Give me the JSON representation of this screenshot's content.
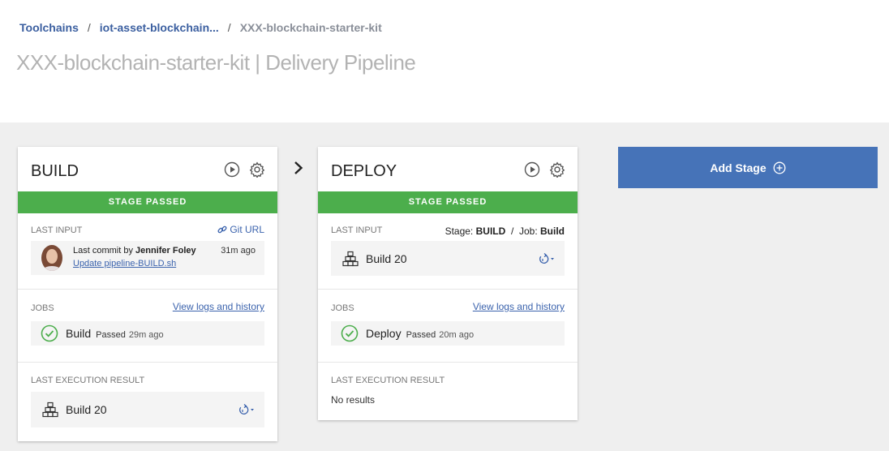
{
  "breadcrumb": {
    "toolchains": "Toolchains",
    "separator": "/",
    "toolchain": "iot-asset-blockchain...",
    "current": "XXX-blockchain-starter-kit"
  },
  "page_title": "XXX-blockchain-starter-kit | Delivery Pipeline",
  "colors": {
    "passed": "#4cae4c",
    "accent": "#4673b8",
    "link": "#3b63ad"
  },
  "stages": {
    "build": {
      "name": "BUILD",
      "status": "STAGE PASSED",
      "last_input_label": "LAST INPUT",
      "git_url_label": "Git URL",
      "commit": {
        "prefix": "Last commit by",
        "author": "Jennifer Foley",
        "time": "31m ago",
        "message": "Update pipeline-BUILD.sh"
      },
      "jobs_label": "JOBS",
      "view_logs": "View logs and history",
      "job": {
        "name": "Build",
        "status": "Passed",
        "time": "29m ago"
      },
      "last_result_label": "LAST EXECUTION RESULT",
      "result_build": "Build 20"
    },
    "deploy": {
      "name": "DEPLOY",
      "status": "STAGE PASSED",
      "last_input_label": "LAST INPUT",
      "source_stage_label": "Stage:",
      "source_stage": "BUILD",
      "source_sep": "/",
      "source_job_label": "Job:",
      "source_job": "Build",
      "input_build": "Build 20",
      "jobs_label": "JOBS",
      "view_logs": "View logs and history",
      "job": {
        "name": "Deploy",
        "status": "Passed",
        "time": "20m ago"
      },
      "last_result_label": "LAST EXECUTION RESULT",
      "no_results": "No results"
    }
  },
  "add_stage_label": "Add Stage",
  "icons": [
    "play-icon",
    "gear-icon",
    "link-icon",
    "check-circle-icon",
    "build-blocks-icon",
    "redeploy-icon",
    "chevron-right-icon",
    "plus-circle-icon"
  ]
}
